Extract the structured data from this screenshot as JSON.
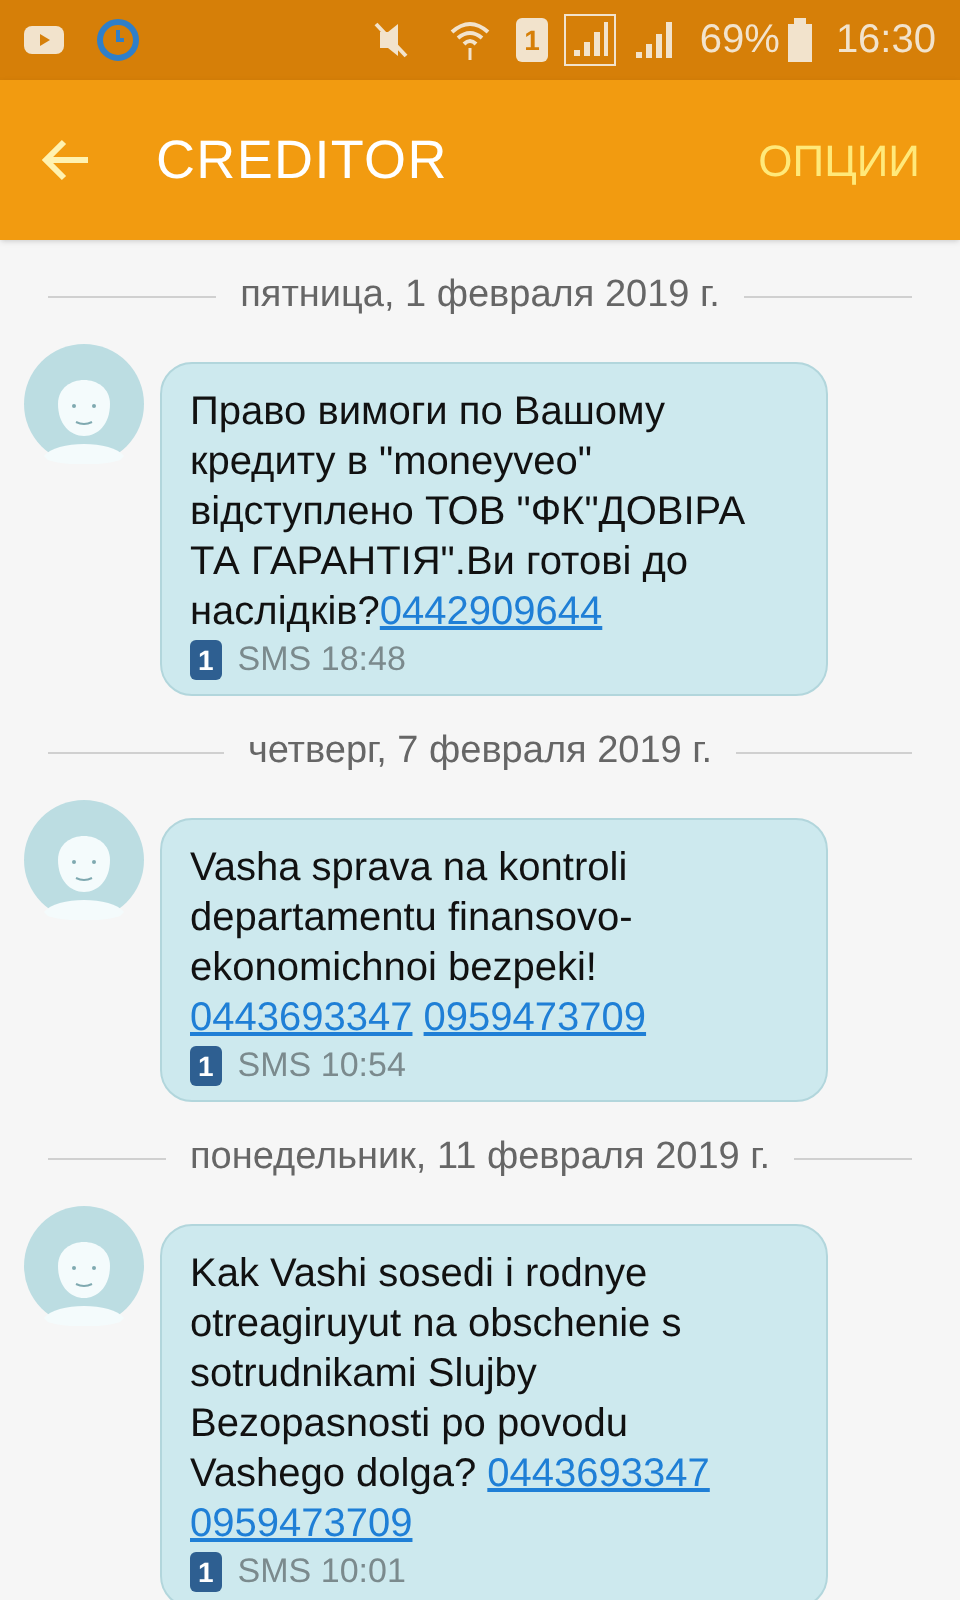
{
  "status_bar": {
    "sim": "1",
    "battery": "69%",
    "time": "16:30"
  },
  "app_bar": {
    "title": "CREDITOR",
    "action": "ОПЦИИ"
  },
  "conversation": [
    {
      "kind": "date",
      "text": "пятница, 1 февраля 2019 г."
    },
    {
      "kind": "message",
      "parts": [
        {
          "kind": "text",
          "text": "Право вимоги по Вашому кредиту в \"moneyveo\" відступлено ТОВ \"ФК\"ДОВІРА ТА ГАРАНТІЯ\".Ви готові до наслідків?"
        },
        {
          "kind": "link",
          "text": "0442909644"
        }
      ],
      "sim": "1",
      "meta": "SMS 18:48"
    },
    {
      "kind": "date",
      "text": "четверг, 7 февраля 2019 г."
    },
    {
      "kind": "message",
      "parts": [
        {
          "kind": "text",
          "text": "Vasha sprava na kontroli departamentu finansovo-ekonomichnoi bezpeki!"
        },
        {
          "kind": "break"
        },
        {
          "kind": "link",
          "text": "0443693347"
        },
        {
          "kind": "space"
        },
        {
          "kind": "link",
          "text": "0959473709"
        }
      ],
      "sim": "1",
      "meta": "SMS 10:54"
    },
    {
      "kind": "date",
      "text": "понедельник, 11 февраля 2019 г."
    },
    {
      "kind": "message",
      "parts": [
        {
          "kind": "text",
          "text": "Kak Vashi sosedi i rodnye otreagiruyut na obschenie s sotrudnikami Slujby Bezopasnosti po povodu Vashego dolga? "
        },
        {
          "kind": "link",
          "text": "0443693347"
        },
        {
          "kind": "space"
        },
        {
          "kind": "link",
          "text": "0959473709"
        }
      ],
      "sim": "1",
      "meta": "SMS 10:01"
    }
  ]
}
